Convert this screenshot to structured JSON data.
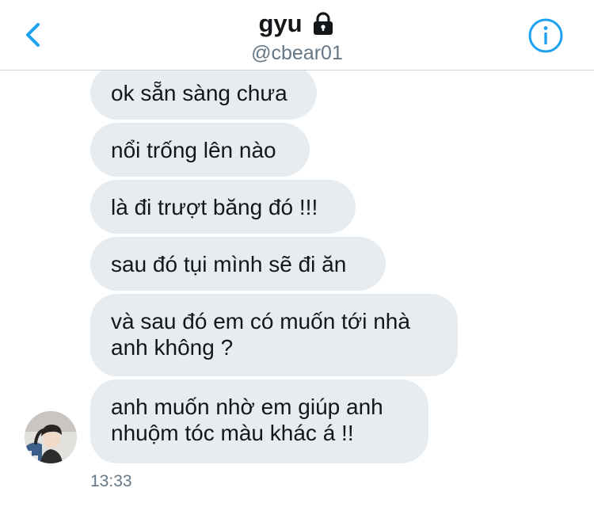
{
  "header": {
    "title": "gyu",
    "handle": "@cbear01",
    "back_icon": "chevron-left-icon",
    "lock_icon": "lock-icon",
    "info_icon": "info-icon"
  },
  "messages": [
    {
      "text": "ok sẵn sàng chưa"
    },
    {
      "text": "nổi trống lên nào"
    },
    {
      "text": "là đi trượt băng đó !!!"
    },
    {
      "text": "sau đó tụi mình sẽ đi ăn"
    },
    {
      "lines": [
        "và sau đó em có muốn tới nhà",
        "anh không ?"
      ]
    },
    {
      "lines": [
        "anh muốn nhờ em giúp anh",
        "nhuộm tóc màu khác á !!"
      ]
    }
  ],
  "timestamp": "13:33",
  "colors": {
    "accent": "#1da1f2",
    "bubble": "#e6ecf0",
    "text": "#14171a",
    "secondary_text": "#657786"
  }
}
